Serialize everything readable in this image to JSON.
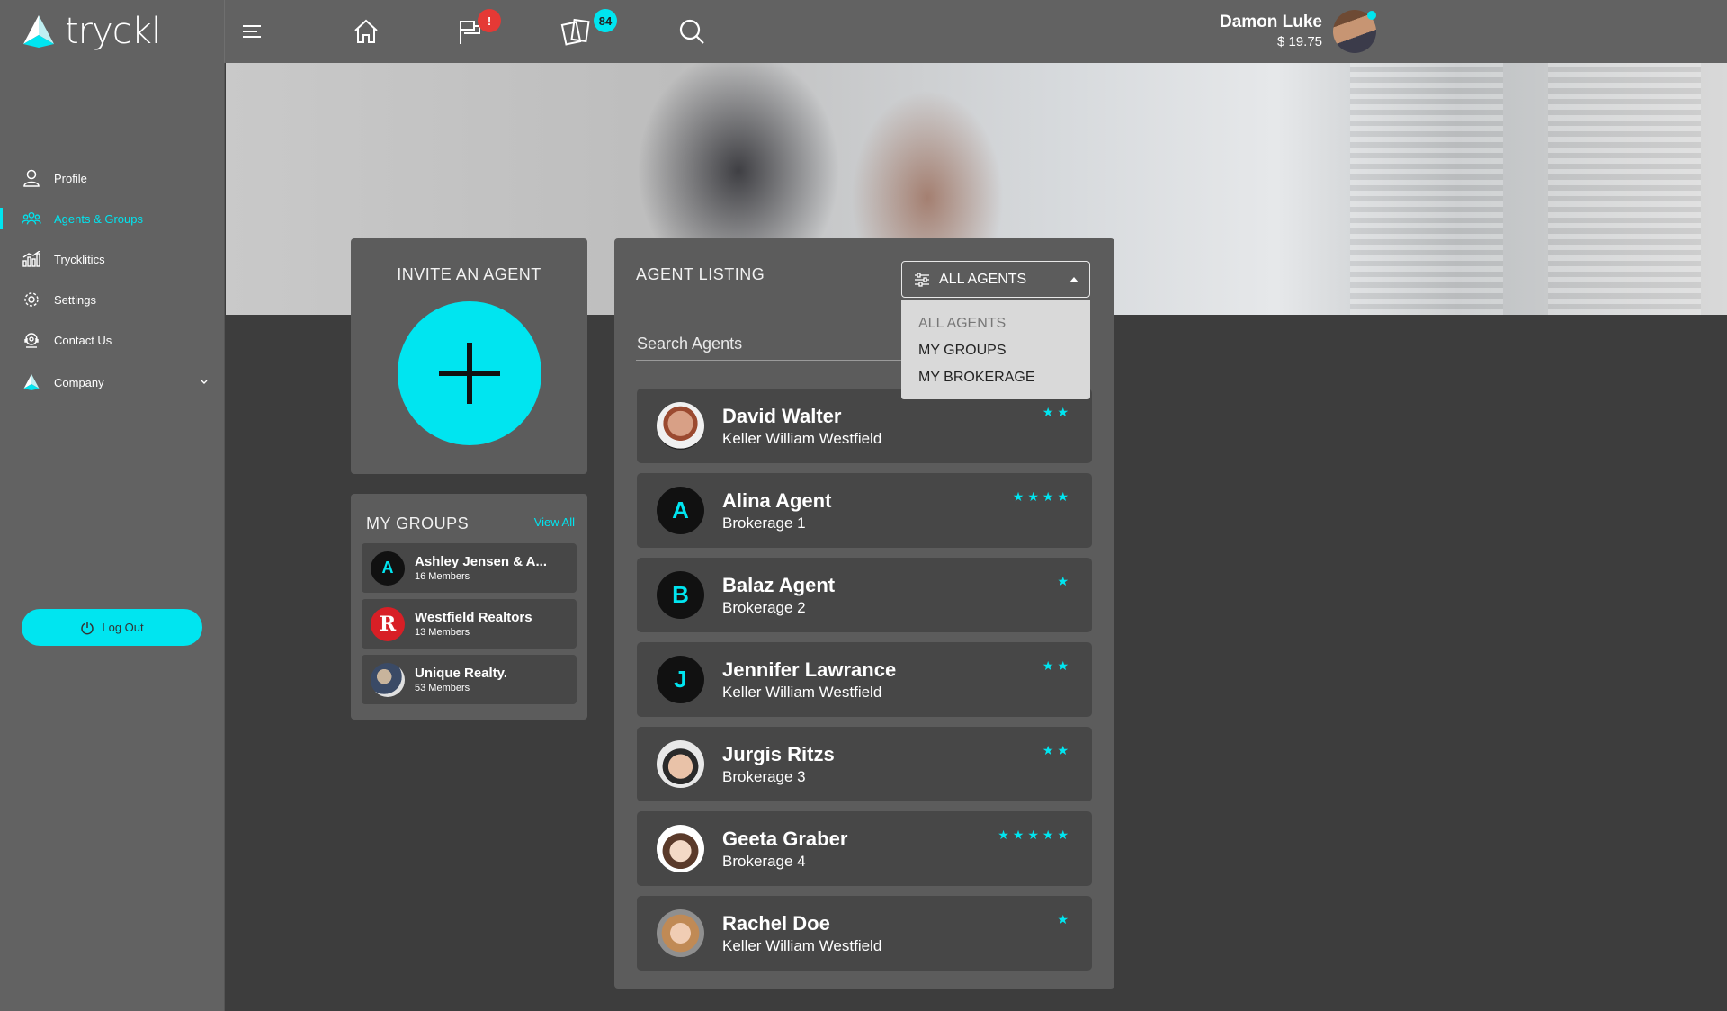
{
  "brand": {
    "name": "tryckl"
  },
  "topbar": {
    "flag_badge": "!",
    "cards_badge": "84",
    "user_name": "Damon Luke",
    "user_balance": "$ 19.75"
  },
  "sidebar": {
    "items": [
      {
        "label": "Profile"
      },
      {
        "label": "Agents & Groups"
      },
      {
        "label": "Trycklitics"
      },
      {
        "label": "Settings"
      },
      {
        "label": "Contact Us"
      },
      {
        "label": "Company"
      }
    ],
    "logout_label": "Log Out"
  },
  "invite": {
    "title": "INVITE AN AGENT"
  },
  "groups": {
    "title": "MY GROUPS",
    "view_all": "View All",
    "items": [
      {
        "initial": "A",
        "name": "Ashley Jensen & A...",
        "members": "16 Members"
      },
      {
        "initial": "R",
        "name": "Westfield Realtors",
        "members": "13 Members"
      },
      {
        "initial": "",
        "name": "Unique Realty.",
        "members": "53 Members"
      }
    ]
  },
  "listing": {
    "title": "AGENT LISTING",
    "search_placeholder": "Search Agents",
    "filter_label": "ALL AGENTS",
    "dropdown": [
      "ALL AGENTS",
      "MY GROUPS",
      "MY BROKERAGE"
    ],
    "agents": [
      {
        "initial": "",
        "name": "David Walter",
        "brokerage": "Keller William Westfield",
        "stars": "★★",
        "rating": 2
      },
      {
        "initial": "A",
        "name": "Alina Agent",
        "brokerage": "Brokerage 1",
        "stars": "★★★★",
        "rating": 4
      },
      {
        "initial": "B",
        "name": "Balaz Agent",
        "brokerage": "Brokerage 2",
        "stars": "★",
        "rating": 1
      },
      {
        "initial": "J",
        "name": "Jennifer Lawrance",
        "brokerage": "Keller William Westfield",
        "stars": "★★",
        "rating": 2
      },
      {
        "initial": "",
        "name": "Jurgis Ritzs",
        "brokerage": "Brokerage 3",
        "stars": "★★",
        "rating": 2
      },
      {
        "initial": "",
        "name": "Geeta Graber",
        "brokerage": "Brokerage 4",
        "stars": "★★★★★",
        "rating": 5
      },
      {
        "initial": "",
        "name": "Rachel Doe",
        "brokerage": "Keller William Westfield",
        "stars": "★",
        "rating": 1
      }
    ]
  },
  "colors": {
    "accent": "#00e5f0",
    "panel": "#5c5c5c",
    "row": "#474747",
    "background": "#3d3d3d",
    "topbar": "#626262"
  }
}
